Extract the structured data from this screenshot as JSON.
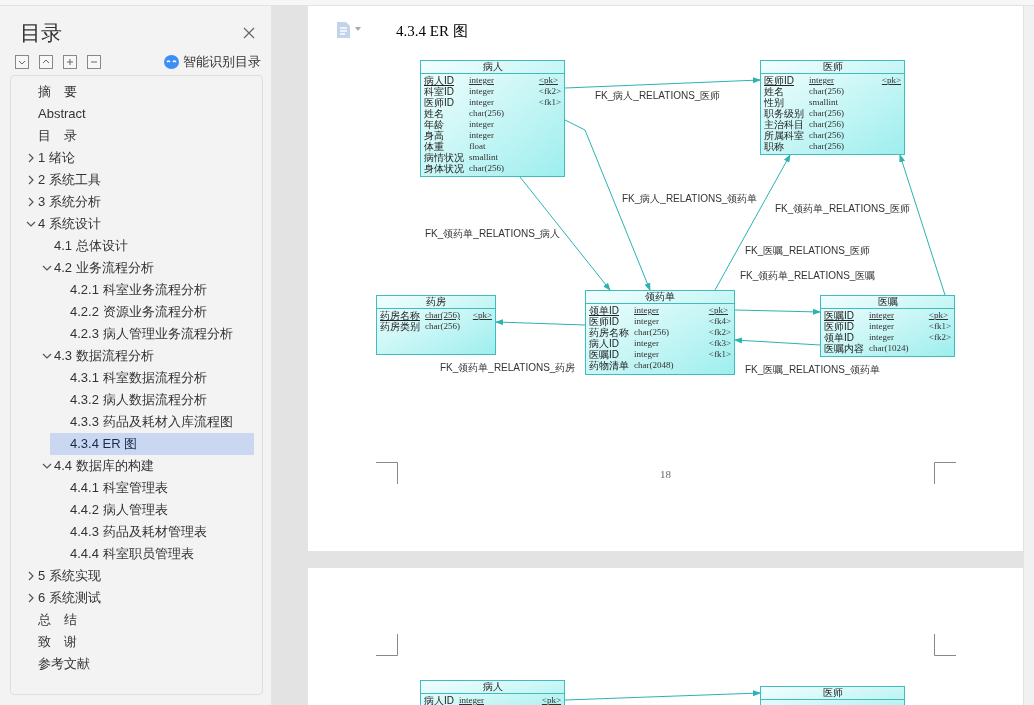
{
  "sidebar": {
    "title": "目录",
    "smart_toc": "智能识别目录",
    "items": [
      {
        "label": "摘　要",
        "selected": false
      },
      {
        "label": "Abstract",
        "selected": false
      },
      {
        "label": "目　录",
        "selected": false
      },
      {
        "label": "1 绪论",
        "selected": false,
        "expanded": false
      },
      {
        "label": "2 系统工具",
        "selected": false,
        "expanded": false
      },
      {
        "label": "3 系统分析",
        "selected": false,
        "expanded": false
      },
      {
        "label": "4 系统设计",
        "selected": false,
        "expanded": true,
        "children": [
          {
            "label": "4.1  总体设计",
            "selected": false
          },
          {
            "label": "4.2  业务流程分析",
            "selected": false,
            "expanded": true,
            "children": [
              {
                "label": "4.2.1  科室业务流程分析",
                "selected": false
              },
              {
                "label": "4.2.2  资源业务流程分析",
                "selected": false
              },
              {
                "label": "4.2.3  病人管理业务流程分析",
                "selected": false
              }
            ]
          },
          {
            "label": "4.3 数据流程分析",
            "selected": false,
            "expanded": true,
            "children": [
              {
                "label": "4.3.1  科室数据流程分析",
                "selected": false
              },
              {
                "label": "4.3.2  病人数据流程分析",
                "selected": false
              },
              {
                "label": "4.3.3  药品及耗材入库流程图",
                "selected": false
              },
              {
                "label": "4.3.4 ER 图",
                "selected": true
              }
            ]
          },
          {
            "label": "4.4 数据库的构建",
            "selected": false,
            "expanded": true,
            "children": [
              {
                "label": "4.4.1  科室管理表",
                "selected": false
              },
              {
                "label": "4.4.2  病人管理表",
                "selected": false
              },
              {
                "label": "4.4.3  药品及耗材管理表",
                "selected": false
              },
              {
                "label": "4.4.4  科室职员管理表",
                "selected": false
              }
            ]
          }
        ]
      },
      {
        "label": "5 系统实现",
        "selected": false,
        "expanded": false
      },
      {
        "label": "6 系统测试",
        "selected": false,
        "expanded": false
      },
      {
        "label": "总　结",
        "selected": false
      },
      {
        "label": "致　谢",
        "selected": false
      },
      {
        "label": "参考文献",
        "selected": false
      }
    ]
  },
  "page": {
    "heading": "4.3.4 ER 图",
    "page_number": "18",
    "diagram": {
      "entities": [
        {
          "title": "病人",
          "columns": [
            {
              "name": "病人ID",
              "type": "integer",
              "key": "<pk>"
            },
            {
              "name": "科室ID",
              "type": "integer",
              "key": "<fk2>"
            },
            {
              "name": "医师ID",
              "type": "integer",
              "key": "<fk1>"
            },
            {
              "name": "姓名",
              "type": "char(256)"
            },
            {
              "name": "年龄",
              "type": "integer"
            },
            {
              "name": "身高",
              "type": "integer"
            },
            {
              "name": "体重",
              "type": "float"
            },
            {
              "name": "病情状况",
              "type": "smallint"
            },
            {
              "name": "身体状况",
              "type": "char(256)"
            }
          ]
        },
        {
          "title": "医师",
          "columns": [
            {
              "name": "医师ID",
              "type": "integer",
              "key": "<pk>"
            },
            {
              "name": "姓名",
              "type": "char(256)"
            },
            {
              "name": "性别",
              "type": "smallint"
            },
            {
              "name": "职务级别",
              "type": "char(256)"
            },
            {
              "name": "主治科目",
              "type": "char(256)"
            },
            {
              "name": "所属科室",
              "type": "char(256)"
            },
            {
              "name": "职称",
              "type": "char(256)"
            }
          ]
        },
        {
          "title": "药房",
          "columns": [
            {
              "name": "药房名称",
              "type": "char(256)",
              "key": "<pk>"
            },
            {
              "name": "药房类别",
              "type": "char(256)"
            }
          ]
        },
        {
          "title": "领药单",
          "columns": [
            {
              "name": "领单ID",
              "type": "integer",
              "key": "<pk>"
            },
            {
              "name": "医师ID",
              "type": "integer",
              "key": "<fk4>"
            },
            {
              "name": "药房名称",
              "type": "char(256)",
              "key": "<fk2>"
            },
            {
              "name": "病人ID",
              "type": "integer",
              "key": "<fk3>"
            },
            {
              "name": "医嘱ID",
              "type": "integer",
              "key": "<fk1>"
            },
            {
              "name": "药物清单",
              "type": "char(2048)"
            }
          ]
        },
        {
          "title": "医嘱",
          "columns": [
            {
              "name": "医嘱ID",
              "type": "integer",
              "key": "<pk>"
            },
            {
              "name": "医师ID",
              "type": "integer",
              "key": "<fk1>"
            },
            {
              "name": "领单ID",
              "type": "integer",
              "key": "<fk2>"
            },
            {
              "name": "医嘱内容",
              "type": "char(1024)"
            }
          ]
        }
      ],
      "relations": [
        {
          "label": "FK_病人_RELATIONS_医师"
        },
        {
          "label": "FK_病人_RELATIONS_领药单"
        },
        {
          "label": "FK_领药单_RELATIONS_病人"
        },
        {
          "label": "FK_领药单_RELATIONS_医师"
        },
        {
          "label": "FK_医嘱_RELATIONS_医师"
        },
        {
          "label": "FK_领药单_RELATIONS_药房"
        },
        {
          "label": "FK_领药单_RELATIONS_医嘱"
        },
        {
          "label": "FK_医嘱_RELATIONS_领药单"
        }
      ]
    }
  },
  "next_page": {
    "diagram": {
      "entities": [
        {
          "title": "病人",
          "columns": [
            {
              "name": "病人ID",
              "type": "integer",
              "key": "<pk>"
            }
          ]
        },
        {
          "title": "医师"
        }
      ]
    }
  }
}
